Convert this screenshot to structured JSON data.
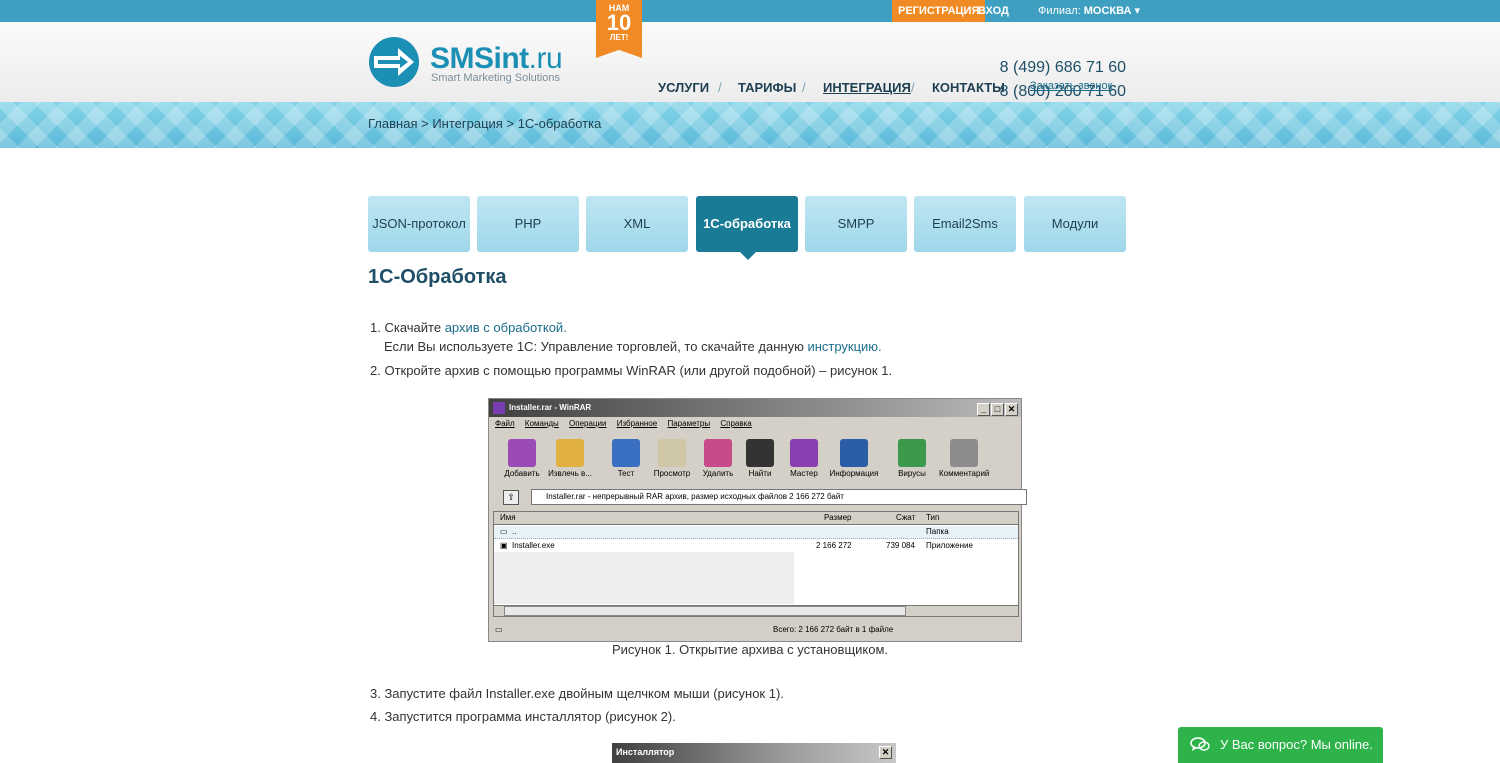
{
  "topbar": {
    "register": "РЕГИСТРАЦИЯ",
    "login": "ВХОД",
    "branch_label": "Филиал:",
    "branch_value": "МОСКВА"
  },
  "badge": {
    "line1": "НАМ",
    "line2": "10",
    "line3": "ЛЕТ!"
  },
  "logo": {
    "name": "SMSint",
    "tld": ".ru",
    "tagline": "Smart Marketing Solutions"
  },
  "nav": {
    "items": [
      "УСЛУГИ",
      "ТАРИФЫ",
      "ИНТЕГРАЦИЯ",
      "КОНТАКТЫ"
    ],
    "separator": "/"
  },
  "contacts": {
    "phone1": "8 (499) 686 71 60",
    "phone2": "8 (800) 200 71 60",
    "callback": "Заказать звонок"
  },
  "breadcrumbs": {
    "items": [
      "Главная",
      "Интеграция",
      "1С-обработка"
    ],
    "separator": ">"
  },
  "tabs": [
    "JSON-протокол",
    "PHP",
    "XML",
    "1С-обработка",
    "SMPP",
    "Email2Sms",
    "Модули"
  ],
  "active_tab": "1С-обработка",
  "page_title": "1С-Обработка",
  "steps": {
    "s1_prefix": "1. Скачайте ",
    "s1_link": "архив с обработкой.",
    "s1_line2_prefix": "Если Вы используете 1С: Управление торговлей, то скачайте данную ",
    "s1_line2_link": "инструкцию.",
    "s2": "2. Откройте архив с помощью программы WinRAR (или другой подобной) – рисунок 1.",
    "s3": "3. Запустите файл Installer.exe двойным щелчком мыши (рисунок 1).",
    "s4": "4. Запустится программа инсталлятор (рисунок 2)."
  },
  "figure1": {
    "title": "Installer.rar - WinRAR",
    "menu": [
      "Файл",
      "Команды",
      "Операции",
      "Избранное",
      "Параметры",
      "Справка"
    ],
    "toolbar": [
      "Добавить",
      "Извлечь в...",
      "Тест",
      "Просмотр",
      "Удалить",
      "Найти",
      "Мастер",
      "Информация",
      "Вирусы",
      "Комментарий"
    ],
    "toolbar_colors": [
      "#9b4bb8",
      "#e0b040",
      "#3b6fc2",
      "#cfc7a8",
      "#c94a8b",
      "#333333",
      "#8a3fb0",
      "#2c5ea8",
      "#3b9a4c",
      "#8c8c8c"
    ],
    "address": "Installer.rar - непрерывный RAR архив, размер исходных файлов 2 166 272 байт",
    "columns": [
      "Имя",
      "Размер",
      "Сжат",
      "Тип"
    ],
    "rows": [
      {
        "name": "..",
        "size": "",
        "packed": "",
        "type": "Папка"
      },
      {
        "name": "Installer.exe",
        "size": "2 166 272",
        "packed": "739 084",
        "type": "Приложение"
      }
    ],
    "status": "Всего: 2 166 272 байт в 1 файле",
    "caption": "Рисунок 1. Открытие архива с установщиком."
  },
  "figure2": {
    "title": "Инсталлятор"
  },
  "chat": {
    "label": "У Вас вопрос? Мы online."
  },
  "colors": {
    "accent": "#1a7b96",
    "topbar": "#3e9fc0",
    "orange": "#f08a24",
    "chat": "#2db34a"
  }
}
